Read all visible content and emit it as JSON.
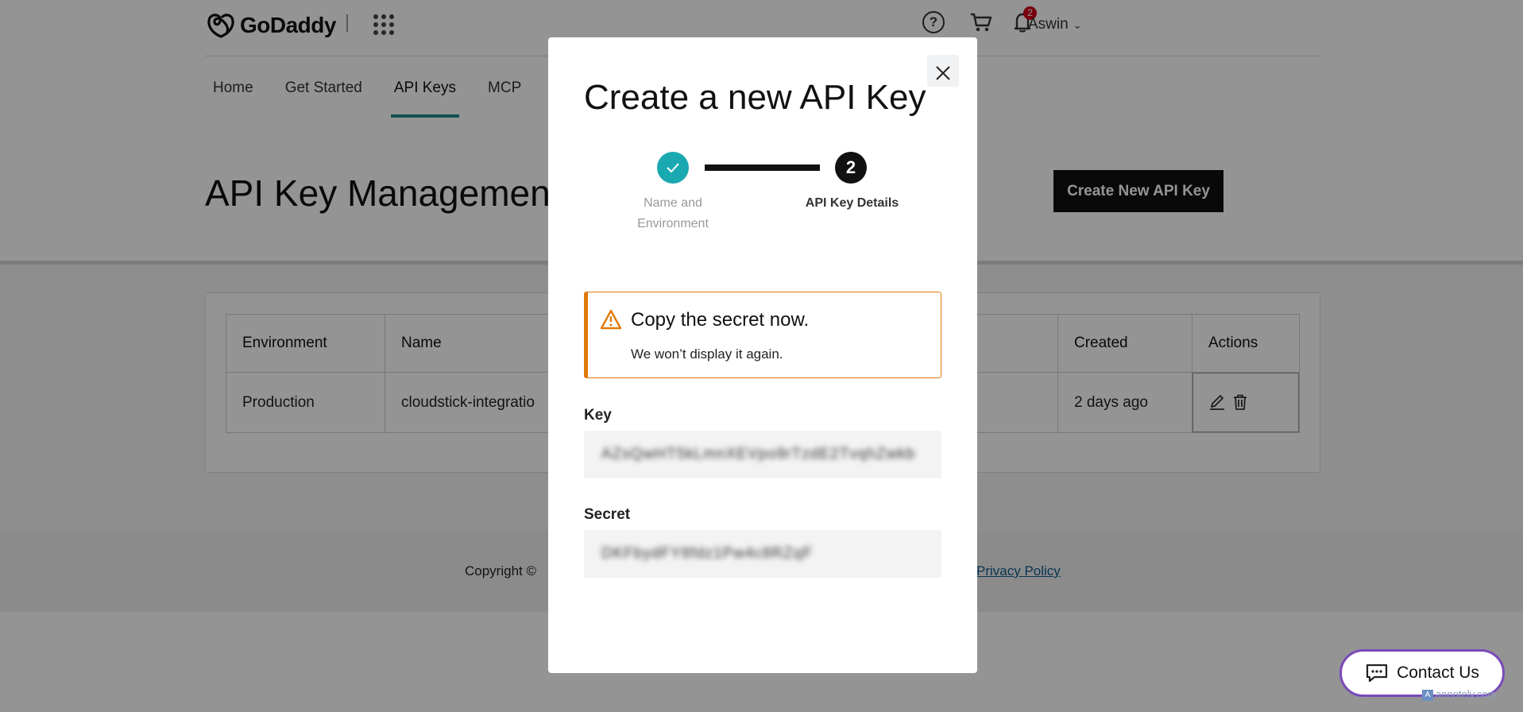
{
  "header": {
    "brand": "GoDaddy",
    "separator": "|",
    "cart_count": "2",
    "user_name": "Aswin",
    "help_glyph": "?"
  },
  "nav": {
    "tabs": [
      {
        "label": "Home"
      },
      {
        "label": "Get Started"
      },
      {
        "label": "API Keys",
        "active": true
      },
      {
        "label": "MCP"
      }
    ]
  },
  "main": {
    "title": "API Key Management",
    "create_button": "Create New API Key"
  },
  "table": {
    "headers": [
      "Environment",
      "Name",
      "Created",
      "Actions"
    ],
    "rows": [
      {
        "environment": "Production",
        "name": "cloudstick-integratio",
        "created": "2 days ago"
      }
    ]
  },
  "footer": {
    "copyright": "Copyright ©",
    "privacy": "Privacy Policy"
  },
  "modal": {
    "title": "Create a new API Key",
    "steps": [
      {
        "label": "Name and Environment",
        "state": "complete"
      },
      {
        "number": "2",
        "label": "API Key Details",
        "state": "current"
      }
    ],
    "alert": {
      "title": "Copy the secret now.",
      "body": "We won’t display it again.",
      "color": "#e07a0a"
    },
    "key_label": "Key",
    "key_value": "AZsQwHT5kLmnXEVpo9rTzdE2TvqhZwkb",
    "secret_label": "Secret",
    "secret_value": "DKFbydFY8fdz1Pw4c8RZqF"
  },
  "contact": {
    "label": "Contact Us"
  },
  "watermark": "annotely.com",
  "colors": {
    "accent": "#1aa9b1",
    "nav_underline": "#1b8b8b",
    "contact_border": "#7a4ab8",
    "badge": "#d0021b"
  }
}
